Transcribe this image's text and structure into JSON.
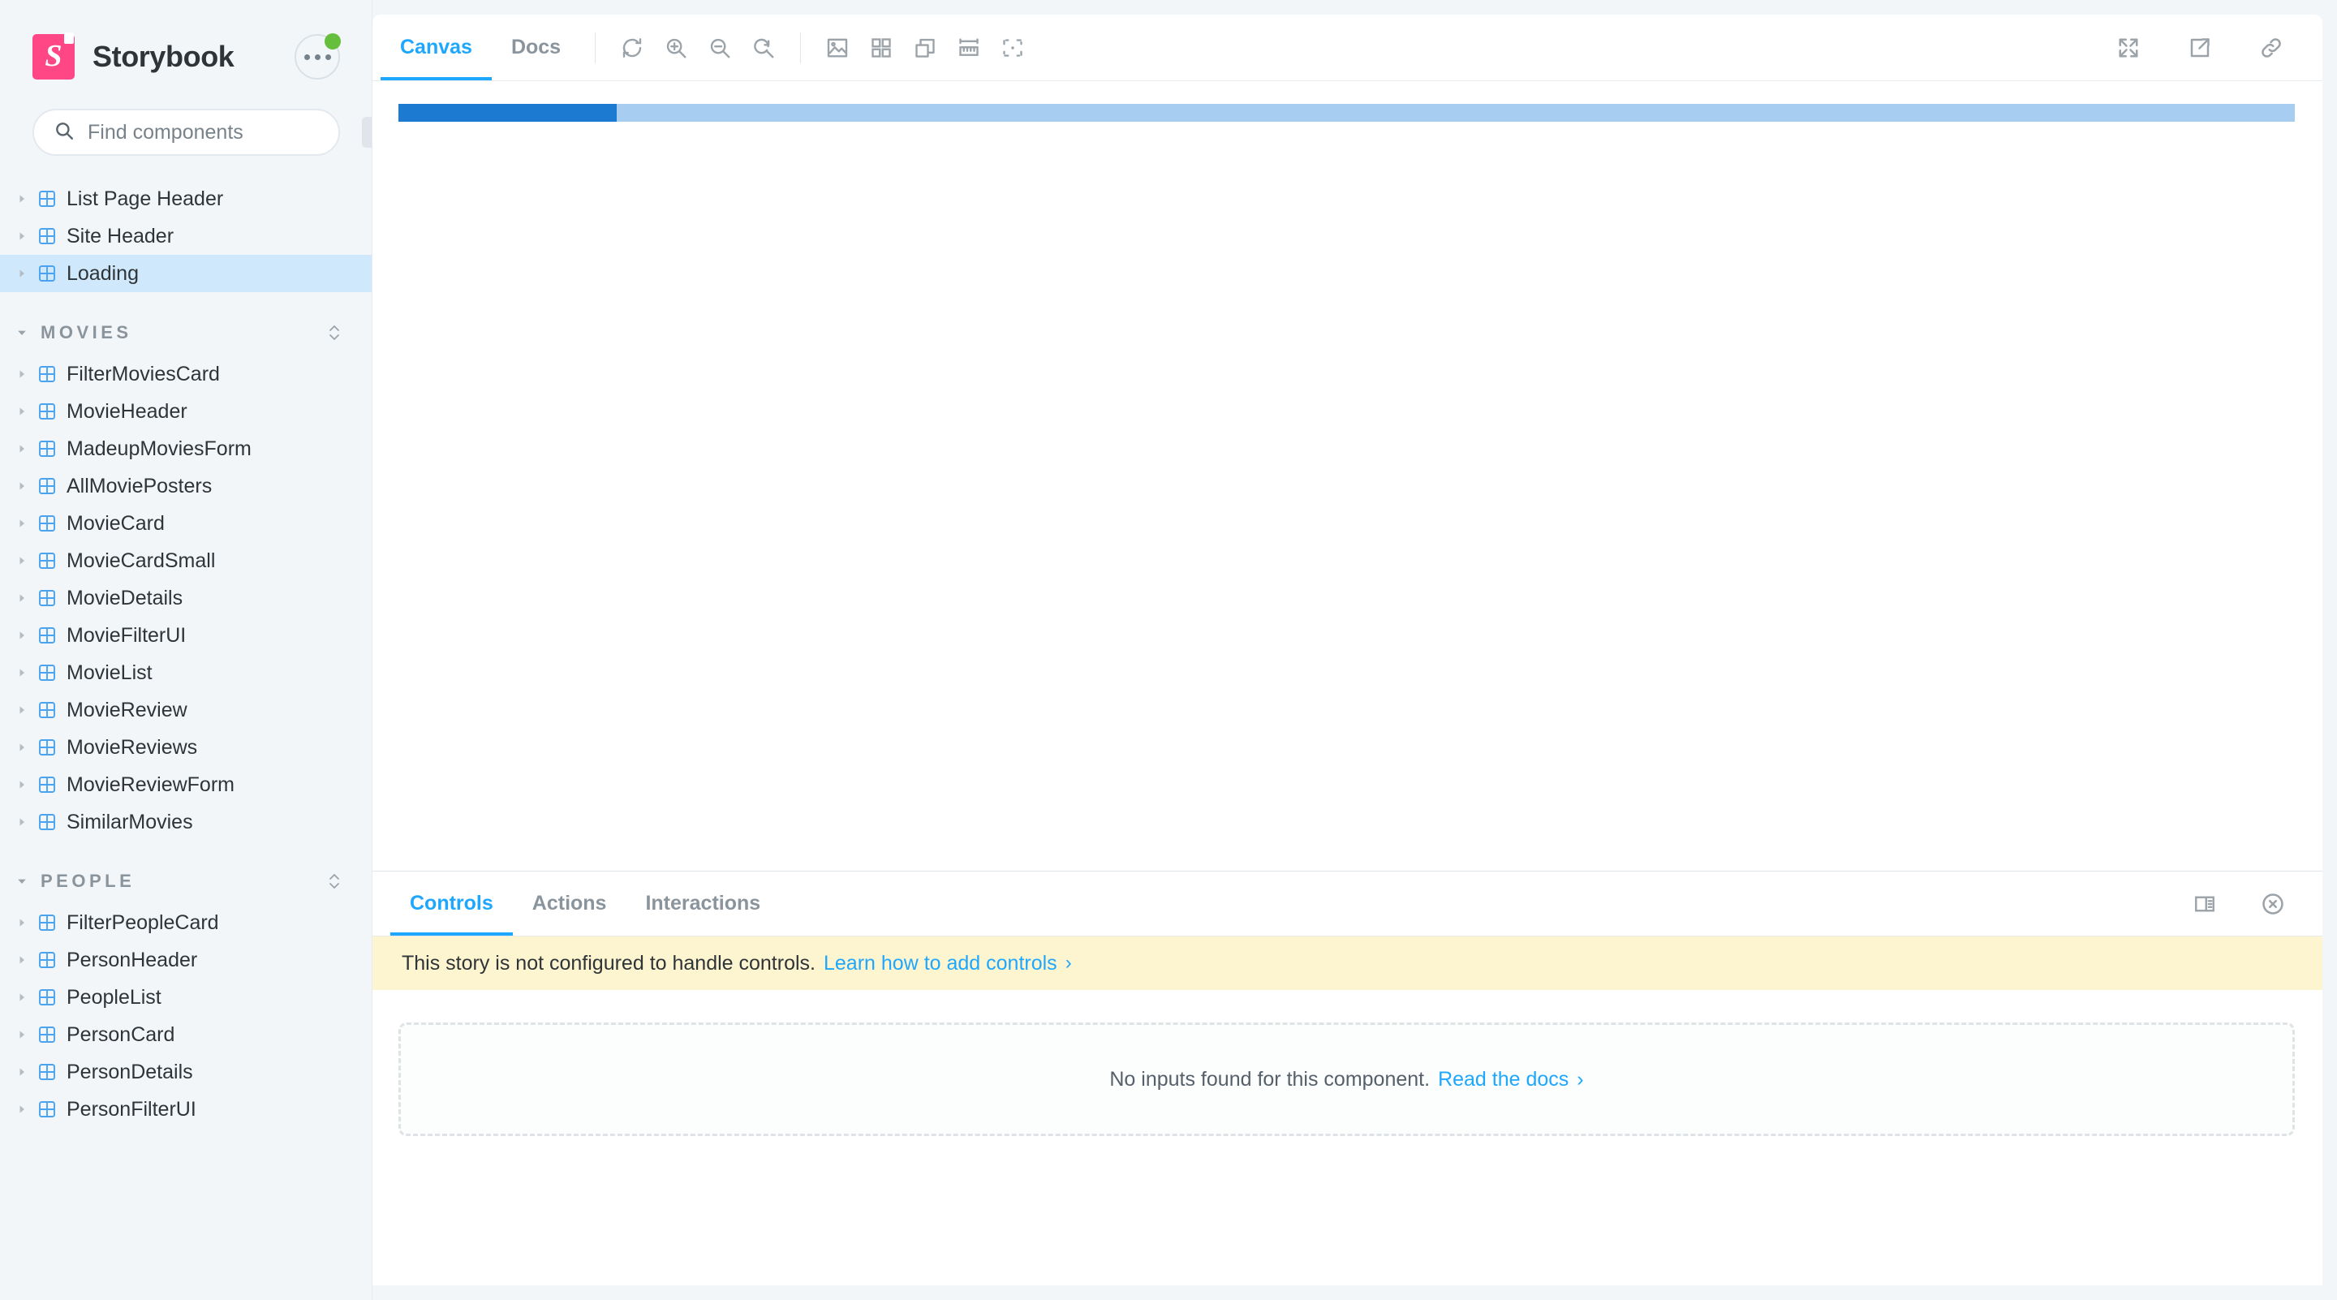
{
  "app": {
    "brand": "Storybook",
    "logo_letter": "S",
    "accent": "#1ea7fd",
    "brand_color": "#ff4785",
    "status_color": "#66bf3c"
  },
  "sidebar": {
    "menu_button_label": "…",
    "search": {
      "placeholder": "Find components",
      "value": "",
      "shortcut": "/"
    },
    "root_items": [
      {
        "label": "List Page Header",
        "selected": false
      },
      {
        "label": "Site Header",
        "selected": false
      },
      {
        "label": "Loading",
        "selected": true
      }
    ],
    "groups": [
      {
        "label": "MOVIES",
        "expanded": true,
        "items": [
          {
            "label": "FilterMoviesCard"
          },
          {
            "label": "MovieHeader"
          },
          {
            "label": "MadeupMoviesForm"
          },
          {
            "label": "AllMoviePosters"
          },
          {
            "label": "MovieCard"
          },
          {
            "label": "MovieCardSmall"
          },
          {
            "label": "MovieDetails"
          },
          {
            "label": "MovieFilterUI"
          },
          {
            "label": "MovieList"
          },
          {
            "label": "MovieReview"
          },
          {
            "label": "MovieReviews"
          },
          {
            "label": "MovieReviewForm"
          },
          {
            "label": "SimilarMovies"
          }
        ]
      },
      {
        "label": "PEOPLE",
        "expanded": true,
        "items": [
          {
            "label": "FilterPeopleCard"
          },
          {
            "label": "PersonHeader"
          },
          {
            "label": "PeopleList"
          },
          {
            "label": "PersonCard"
          },
          {
            "label": "PersonDetails"
          },
          {
            "label": "PersonFilterUI"
          }
        ]
      }
    ]
  },
  "toolbar": {
    "tabs": [
      {
        "label": "Canvas",
        "active": true
      },
      {
        "label": "Docs",
        "active": false
      }
    ],
    "tools": [
      {
        "name": "remount-icon"
      },
      {
        "name": "zoom-in-icon"
      },
      {
        "name": "zoom-out-icon"
      },
      {
        "name": "zoom-reset-icon"
      },
      {
        "name": "backgrounds-icon"
      },
      {
        "name": "grid-icon"
      },
      {
        "name": "outline-icon"
      },
      {
        "name": "measure-icon"
      },
      {
        "name": "focus-icon"
      }
    ],
    "right_tools": [
      {
        "name": "fullscreen-icon"
      },
      {
        "name": "open-in-new-tab-icon"
      },
      {
        "name": "copy-link-icon"
      }
    ]
  },
  "canvas": {
    "progress_percent": 11.5,
    "progress_fill_color": "#1c7bd0",
    "progress_track_color": "#a7cdf0"
  },
  "panel": {
    "tabs": [
      {
        "label": "Controls",
        "active": true
      },
      {
        "label": "Actions",
        "active": false
      },
      {
        "label": "Interactions",
        "active": false
      }
    ],
    "right_tools": [
      {
        "name": "panel-position-icon"
      },
      {
        "name": "close-panel-icon"
      }
    ],
    "warning": {
      "text": "This story is not configured to handle controls.",
      "link": "Learn how to add controls",
      "chevron": "›"
    },
    "empty": {
      "text": "No inputs found for this component.",
      "link": "Read the docs",
      "chevron": "›"
    }
  }
}
